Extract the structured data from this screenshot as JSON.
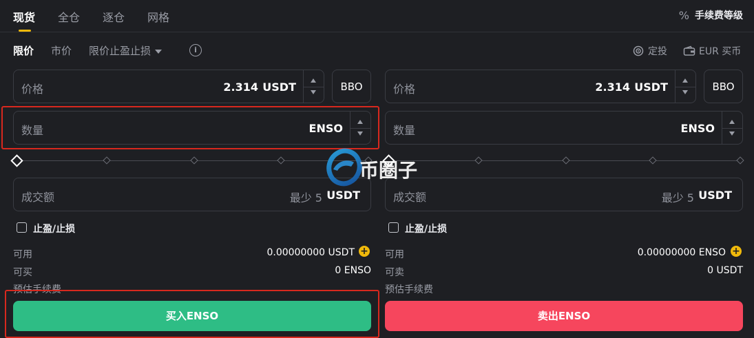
{
  "tabs": [
    "现货",
    "全仓",
    "逐仓",
    "网格"
  ],
  "fee_level": {
    "icon": "percent-icon",
    "label": "手续费等级",
    "symbol": "%"
  },
  "order_types": {
    "limit": "限价",
    "market": "市价",
    "stop": "限价止盈止损"
  },
  "info_symbol": "i",
  "tools": {
    "auto_invest": "定投",
    "buy_crypto": "EUR 买币"
  },
  "buy": {
    "price_label": "价格",
    "price_value": "2.314",
    "price_unit": "USDT",
    "bbo": "BBO",
    "amount_label": "数量",
    "amount_unit": "ENSO",
    "slider_value_percent": 0,
    "total_label": "成交额",
    "total_hint": "最少 5",
    "total_unit": "USDT",
    "tpsl_label": "止盈/止损",
    "avail_label": "可用",
    "avail_value": "0.00000000 USDT",
    "max_label": "可买",
    "max_value": "0 ENSO",
    "fee_label": "预估手续费",
    "button": "买入ENSO"
  },
  "sell": {
    "price_label": "价格",
    "price_value": "2.314",
    "price_unit": "USDT",
    "bbo": "BBO",
    "amount_label": "数量",
    "amount_unit": "ENSO",
    "slider_value_percent": 0,
    "total_label": "成交额",
    "total_hint": "最少 5",
    "total_unit": "USDT",
    "tpsl_label": "止盈/止损",
    "avail_label": "可用",
    "avail_value": "0.00000000 ENSO",
    "max_label": "可卖",
    "max_value": "0 USDT",
    "fee_label": "预估手续费",
    "button": "卖出ENSO"
  },
  "watermark": {
    "text": "币圈子"
  },
  "colors": {
    "accent": "#f0b90b",
    "buy": "#2ebd85",
    "sell": "#f6465d",
    "highlight": "#d8281e",
    "bg": "#1e1f23"
  }
}
